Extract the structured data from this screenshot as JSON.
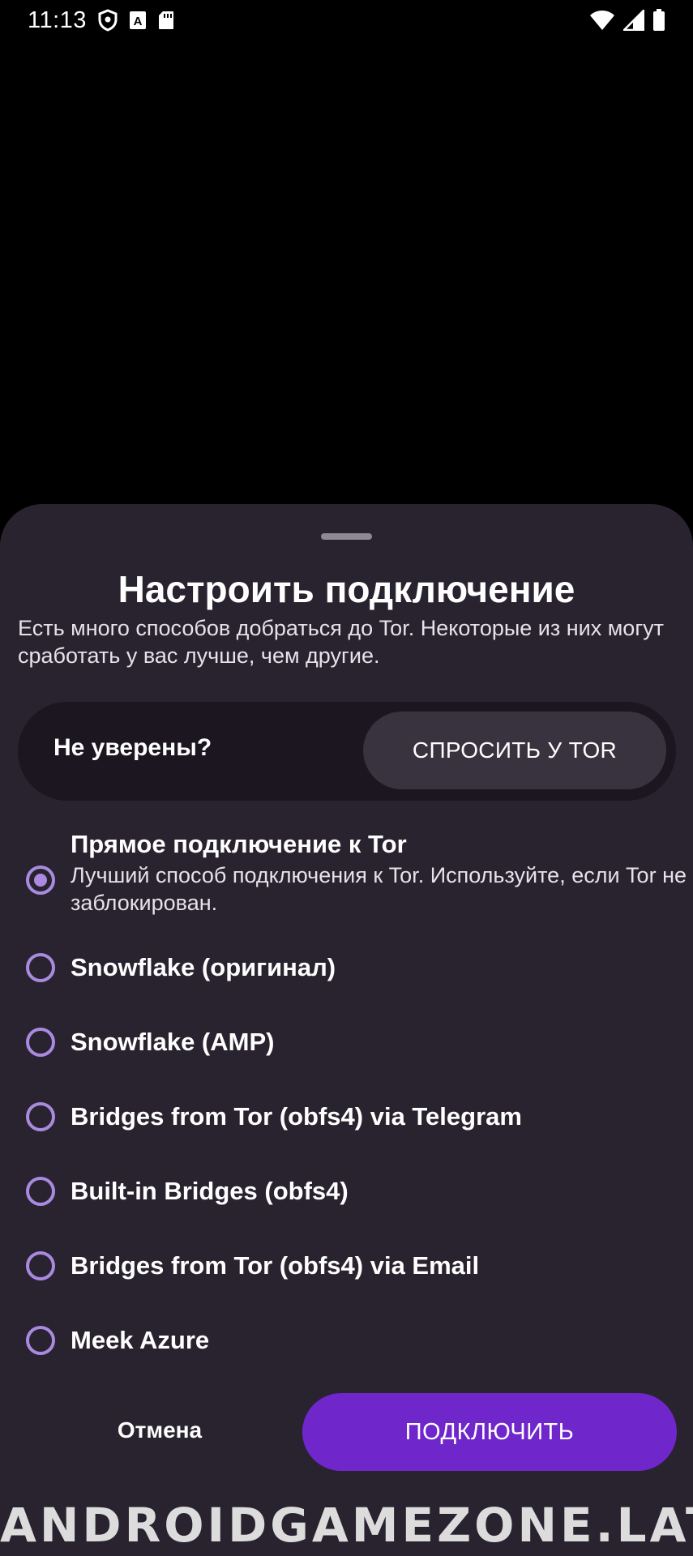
{
  "status_bar": {
    "time": "11:13",
    "left_icons": [
      "shield-icon",
      "text-a-icon",
      "sd-card-icon"
    ],
    "right_icons": [
      "wifi-icon",
      "signal-icon",
      "battery-icon"
    ]
  },
  "sheet": {
    "title": "Настроить подключение",
    "description": "Есть много способов добраться до Tor. Некоторые из них могут сработать у вас лучше, чем другие.",
    "ask": {
      "label": "Не уверены?",
      "button": "СПРОСИТЬ У TOR"
    },
    "options": [
      {
        "label": "Прямое подключение к Tor",
        "description": "Лучший способ подключения к Tor. Используйте, если Tor не заблокирован.",
        "selected": true
      },
      {
        "label": "Snowflake (оригинал)",
        "selected": false
      },
      {
        "label": "Snowflake (AMP)",
        "selected": false
      },
      {
        "label": "Bridges from Tor (obfs4) via Telegram",
        "selected": false
      },
      {
        "label": "Built-in Bridges (obfs4)",
        "selected": false
      },
      {
        "label": "Bridges from Tor (obfs4) via Email",
        "selected": false
      },
      {
        "label": "Meek Azure",
        "selected": false
      }
    ],
    "cancel": "Отмена",
    "connect": "ПОДКЛЮЧИТЬ"
  },
  "watermark": "ANDROIDGAMEZONE.LAT",
  "colors": {
    "background": "#000000",
    "sheet": "#29232f",
    "accent": "#6f27cc",
    "radio": "#a98ae0"
  }
}
